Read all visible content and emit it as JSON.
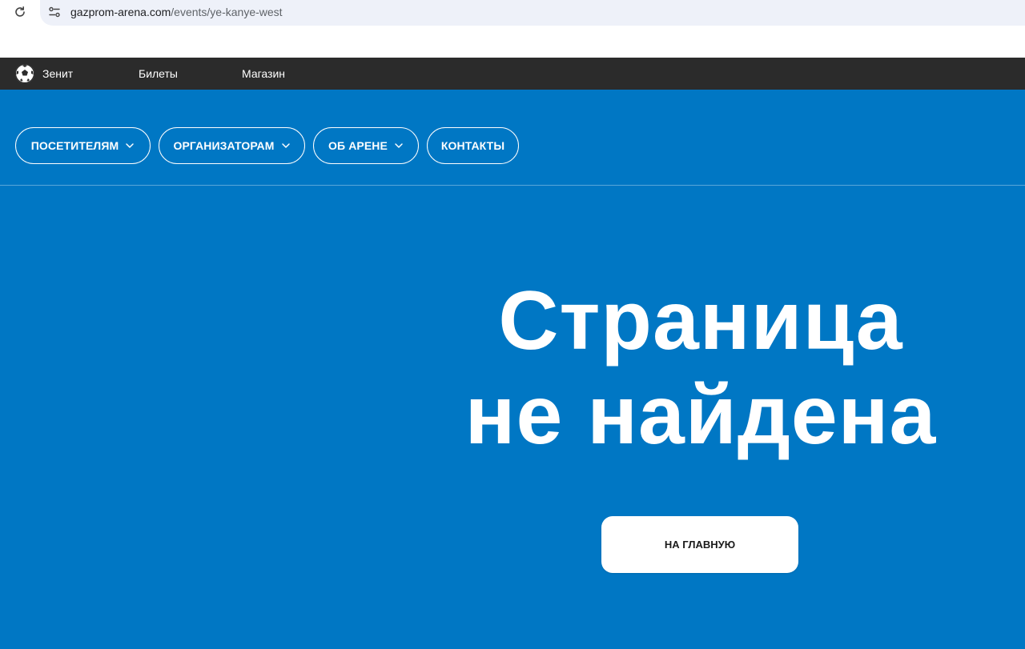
{
  "browser": {
    "url_host": "gazprom-arena.com",
    "url_path": "/events/ye-kanye-west",
    "reload_icon": "reload-icon",
    "site_info_icon": "site-info-icon"
  },
  "top_nav": {
    "logo_icon": "soccer-ball-icon",
    "links": [
      {
        "label": "Зенит"
      },
      {
        "label": "Билеты"
      },
      {
        "label": "Магазин"
      }
    ]
  },
  "sub_nav": {
    "items": [
      {
        "label": "ПОСЕТИТЕЛЯМ",
        "has_dropdown": true
      },
      {
        "label": "ОРГАНИЗАТОРАМ",
        "has_dropdown": true
      },
      {
        "label": "ОБ АРЕНЕ",
        "has_dropdown": true
      },
      {
        "label": "КОНТАКТЫ",
        "has_dropdown": false
      }
    ]
  },
  "error": {
    "title_line1": "Страница",
    "title_line2": "не найдена",
    "home_button_label": "НА ГЛАВНУЮ"
  },
  "colors": {
    "background_blue": "#0077c4",
    "top_nav": "#2b2b2b",
    "text": "#ffffff"
  }
}
